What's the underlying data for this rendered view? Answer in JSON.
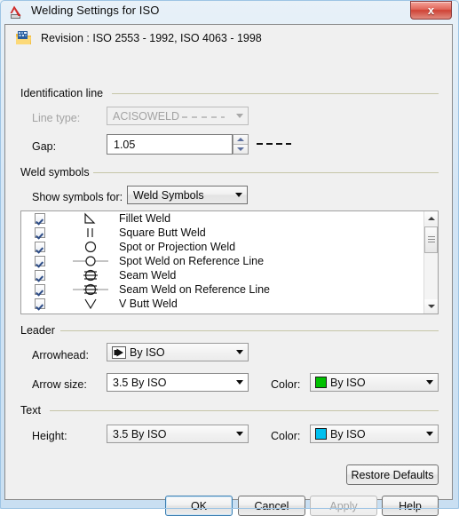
{
  "window": {
    "title": "Welding Settings for ISO",
    "title_icon": "autocad-logo-icon",
    "close_label": "x"
  },
  "revision": {
    "icon": "revision-folder-icon",
    "text": "Revision : ISO 2553 - 1992, ISO 4063 - 1998"
  },
  "identification_line": {
    "group_label": "Identification line",
    "line_type": {
      "label": "Line type:",
      "value": "ACISOWELD",
      "disabled": true
    },
    "gap": {
      "label": "Gap:",
      "value": "1.05",
      "preview": "dashed-line-preview"
    }
  },
  "weld_symbols": {
    "group_label": "Weld symbols",
    "show_symbols_for": {
      "label": "Show symbols for:",
      "value": "Weld Symbols"
    },
    "items": [
      {
        "label": "Fillet Weld",
        "checked": true,
        "glyph": "fillet-weld-icon"
      },
      {
        "label": "Square Butt Weld",
        "checked": true,
        "glyph": "square-butt-weld-icon"
      },
      {
        "label": "Spot or Projection Weld",
        "checked": true,
        "glyph": "spot-projection-weld-icon"
      },
      {
        "label": "Spot Weld on Reference Line",
        "checked": true,
        "glyph": "spot-weld-reference-line-icon"
      },
      {
        "label": "Seam Weld",
        "checked": true,
        "glyph": "seam-weld-icon"
      },
      {
        "label": "Seam Weld on Reference Line",
        "checked": true,
        "glyph": "seam-weld-reference-line-icon"
      },
      {
        "label": "V Butt Weld",
        "checked": true,
        "glyph": "v-butt-weld-icon"
      }
    ]
  },
  "leader": {
    "group_label": "Leader",
    "arrowhead": {
      "label": "Arrowhead:",
      "value": "By ISO",
      "icon": "filled-arrowhead-icon"
    },
    "arrow_size": {
      "label": "Arrow size:",
      "value": "3.5  By ISO"
    },
    "color": {
      "label": "Color:",
      "value": "By ISO",
      "swatch": "#00c000"
    }
  },
  "text": {
    "group_label": "Text",
    "height": {
      "label": "Height:",
      "value": "3.5  By ISO"
    },
    "color": {
      "label": "Color:",
      "value": "By ISO",
      "swatch": "#00c0ef"
    }
  },
  "buttons": {
    "restore_defaults": "Restore Defaults",
    "ok": "OK",
    "cancel": "Cancel",
    "apply": "Apply",
    "help": "Help"
  }
}
